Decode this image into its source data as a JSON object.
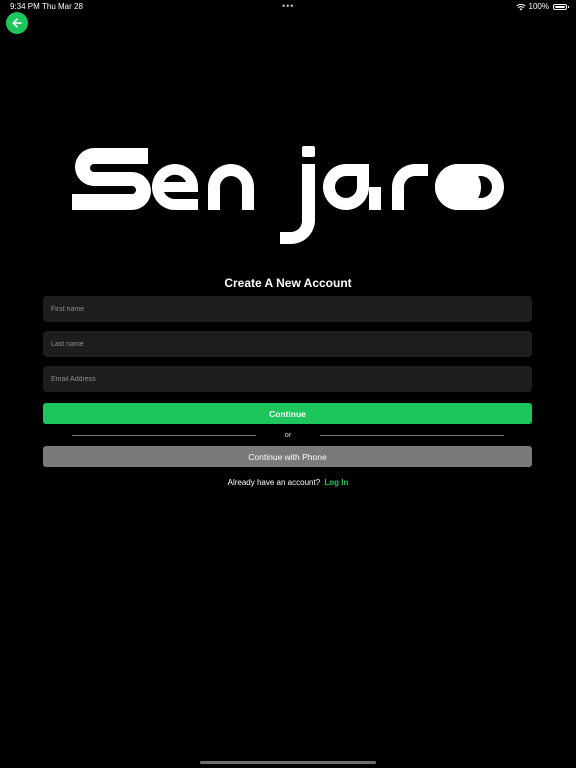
{
  "status_bar": {
    "time": "9:34 PM",
    "date": "Thu Mar 28",
    "dots": "•••",
    "battery_text": "100%"
  },
  "header": {
    "back_icon": "arrow-left-icon"
  },
  "logo": {
    "text": "Senjaro"
  },
  "form": {
    "title": "Create A New Account",
    "first_name_placeholder": "First name",
    "last_name_placeholder": "Last name",
    "email_placeholder": "Email Address",
    "continue_label": "Continue",
    "or_label": "or",
    "phone_label": "Continue with Phone",
    "login_prompt": "Already have an account?",
    "login_link": "Log In"
  },
  "colors": {
    "accent": "#1cc65c",
    "background": "#000000",
    "input_background": "#1e1e1e",
    "secondary_button": "#7a7a7a"
  }
}
